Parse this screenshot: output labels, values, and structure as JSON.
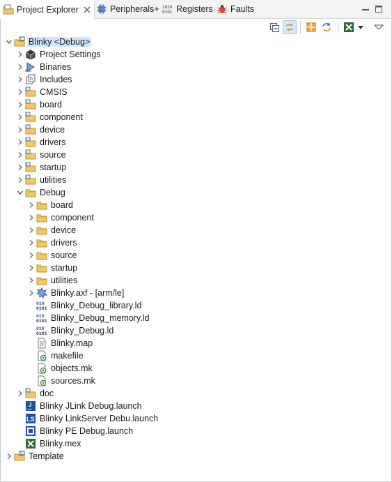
{
  "tabs": [
    {
      "label": "Project Explorer",
      "icon": "project-explorer-icon",
      "active": true
    },
    {
      "label": "Peripherals+",
      "icon": "peripherals-icon",
      "active": false
    },
    {
      "label": "Registers",
      "icon": "registers-icon",
      "active": false
    },
    {
      "label": "Faults",
      "icon": "faults-bug-icon",
      "active": false
    }
  ],
  "toolbar": {
    "buttons": [
      "collapse-all-icon",
      "link-with-editor-icon",
      "config-tools-icon",
      "refresh-sync-icon",
      "mcuxpresso-config-icon",
      "view-menu-icon"
    ]
  },
  "tree": [
    {
      "label": "Blinky <Debug>",
      "depth": 0,
      "twisty": "open",
      "icon": "project",
      "selected": true
    },
    {
      "label": "Project Settings",
      "depth": 1,
      "twisty": "closed",
      "icon": "settings"
    },
    {
      "label": "Binaries",
      "depth": 1,
      "twisty": "closed",
      "icon": "binaries"
    },
    {
      "label": "Includes",
      "depth": 1,
      "twisty": "closed",
      "icon": "includes"
    },
    {
      "label": "CMSIS",
      "depth": 1,
      "twisty": "closed",
      "icon": "srcfolder"
    },
    {
      "label": "board",
      "depth": 1,
      "twisty": "closed",
      "icon": "srcfolder"
    },
    {
      "label": "component",
      "depth": 1,
      "twisty": "closed",
      "icon": "srcfolder"
    },
    {
      "label": "device",
      "depth": 1,
      "twisty": "closed",
      "icon": "srcfolder"
    },
    {
      "label": "drivers",
      "depth": 1,
      "twisty": "closed",
      "icon": "srcfolder"
    },
    {
      "label": "source",
      "depth": 1,
      "twisty": "closed",
      "icon": "srcfolder"
    },
    {
      "label": "startup",
      "depth": 1,
      "twisty": "closed",
      "icon": "srcfolder"
    },
    {
      "label": "utilities",
      "depth": 1,
      "twisty": "closed",
      "icon": "srcfolder"
    },
    {
      "label": "Debug",
      "depth": 1,
      "twisty": "open",
      "icon": "folder"
    },
    {
      "label": "board",
      "depth": 2,
      "twisty": "closed",
      "icon": "folder"
    },
    {
      "label": "component",
      "depth": 2,
      "twisty": "closed",
      "icon": "folder"
    },
    {
      "label": "device",
      "depth": 2,
      "twisty": "closed",
      "icon": "folder"
    },
    {
      "label": "drivers",
      "depth": 2,
      "twisty": "closed",
      "icon": "folder"
    },
    {
      "label": "source",
      "depth": 2,
      "twisty": "closed",
      "icon": "folder"
    },
    {
      "label": "startup",
      "depth": 2,
      "twisty": "closed",
      "icon": "folder"
    },
    {
      "label": "utilities",
      "depth": 2,
      "twisty": "closed",
      "icon": "folder"
    },
    {
      "label": "Blinky.axf - [arm/le]",
      "depth": 2,
      "twisty": "closed",
      "icon": "axf"
    },
    {
      "label": "Blinky_Debug_library.ld",
      "depth": 2,
      "twisty": "none",
      "icon": "ld"
    },
    {
      "label": "Blinky_Debug_memory.ld",
      "depth": 2,
      "twisty": "none",
      "icon": "ld"
    },
    {
      "label": "Blinky_Debug.ld",
      "depth": 2,
      "twisty": "none",
      "icon": "ld"
    },
    {
      "label": "Blinky.map",
      "depth": 2,
      "twisty": "none",
      "icon": "map"
    },
    {
      "label": "makefile",
      "depth": 2,
      "twisty": "none",
      "icon": "make"
    },
    {
      "label": "objects.mk",
      "depth": 2,
      "twisty": "none",
      "icon": "make"
    },
    {
      "label": "sources.mk",
      "depth": 2,
      "twisty": "none",
      "icon": "make"
    },
    {
      "label": "doc",
      "depth": 1,
      "twisty": "closed",
      "icon": "srcfolder"
    },
    {
      "label": "Blinky JLink Debug.launch",
      "depth": 1,
      "twisty": "none",
      "icon": "jlink"
    },
    {
      "label": "Blinky LinkServer Debu.launch",
      "depth": 1,
      "twisty": "none",
      "icon": "linkserver"
    },
    {
      "label": "Blinky PE Debug.launch",
      "depth": 1,
      "twisty": "none",
      "icon": "pe"
    },
    {
      "label": "Blinky.mex",
      "depth": 1,
      "twisty": "none",
      "icon": "mex"
    },
    {
      "label": "Template",
      "depth": 0,
      "twisty": "closed",
      "icon": "project"
    }
  ],
  "colors": {
    "selection": "#cde8ff",
    "folder": "#f3c766",
    "accent": "#1f6fbf"
  }
}
